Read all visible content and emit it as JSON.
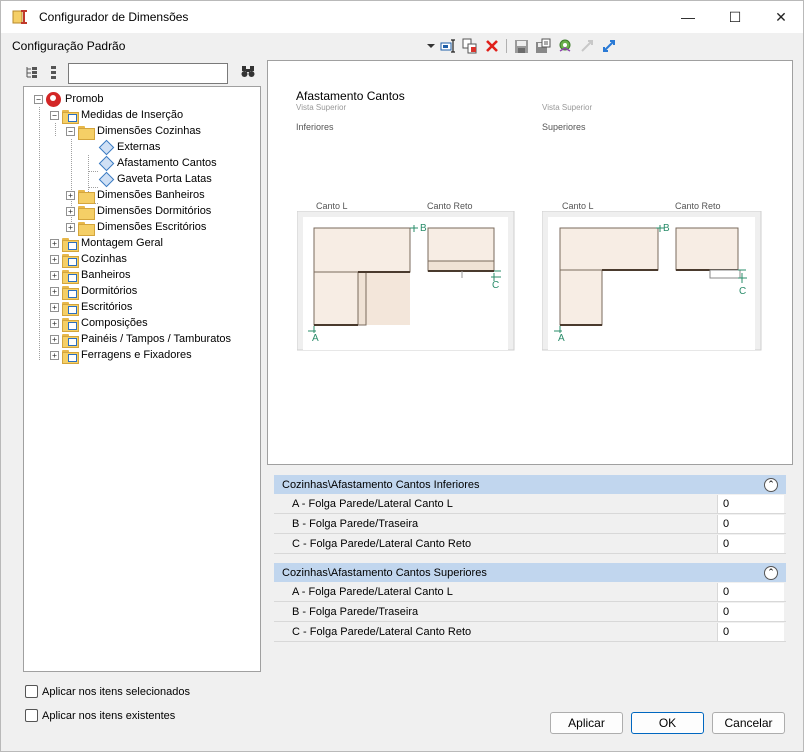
{
  "window": {
    "title": "Configurador de Dimensões",
    "controls": {
      "minimize": "—",
      "maximize": "☐",
      "close": "✕"
    }
  },
  "toolbar": {
    "config_label": "Configuração Padrão",
    "icons": [
      "dropdown-arrow-icon",
      "edit-field-icon",
      "copy-icon",
      "delete-icon",
      "save-icon",
      "save-as-icon",
      "settings-icon",
      "export-icon",
      "import-icon"
    ]
  },
  "tree": {
    "search_value": "",
    "items": [
      {
        "label": "Promob",
        "level": 0
      },
      {
        "label": "Medidas de Inserção",
        "level": 1
      },
      {
        "label": "Dimensões Cozinhas",
        "level": 2
      },
      {
        "label": "Externas",
        "level": 3
      },
      {
        "label": "Afastamento Cantos",
        "level": 3
      },
      {
        "label": "Gaveta Porta Latas",
        "level": 3
      },
      {
        "label": "Dimensões Banheiros",
        "level": 2
      },
      {
        "label": "Dimensões Dormitórios",
        "level": 2
      },
      {
        "label": "Dimensões Escritórios",
        "level": 2
      },
      {
        "label": "Montagem Geral",
        "level": 1
      },
      {
        "label": "Cozinhas",
        "level": 1
      },
      {
        "label": "Banheiros",
        "level": 1
      },
      {
        "label": "Dormitórios",
        "level": 1
      },
      {
        "label": "Escritórios",
        "level": 1
      },
      {
        "label": "Composições",
        "level": 1
      },
      {
        "label": "Painéis / Tampos / Tamburatos",
        "level": 1
      },
      {
        "label": "Ferragens e Fixadores",
        "level": 1
      }
    ]
  },
  "preview": {
    "title": "Afastamento Cantos",
    "left_view": "Vista Superior",
    "right_view": "Vista Superior",
    "left_group": "Inferiores",
    "right_group": "Superiores",
    "canto_l": "Canto L",
    "canto_reto": "Canto Reto",
    "marker_a": "A",
    "marker_b": "B",
    "marker_c": "C"
  },
  "properties": {
    "sections": [
      {
        "header": "Cozinhas\\Afastamento Cantos Inferiores",
        "rows": [
          {
            "name": "A - Folga Parede/Lateral Canto L",
            "value": "0"
          },
          {
            "name": "B - Folga Parede/Traseira",
            "value": "0"
          },
          {
            "name": "C - Folga Parede/Lateral Canto Reto",
            "value": "0"
          }
        ]
      },
      {
        "header": "Cozinhas\\Afastamento Cantos Superiores",
        "rows": [
          {
            "name": "A - Folga Parede/Lateral Canto L",
            "value": "0"
          },
          {
            "name": "B - Folga Parede/Traseira",
            "value": "0"
          },
          {
            "name": "C - Folga Parede/Lateral Canto Reto",
            "value": "0"
          }
        ]
      }
    ]
  },
  "options": {
    "apply_selected": "Aplicar nos itens selecionados",
    "apply_existing": "Aplicar nos itens existentes"
  },
  "buttons": {
    "apply": "Aplicar",
    "ok": "OK",
    "cancel": "Cancelar"
  }
}
